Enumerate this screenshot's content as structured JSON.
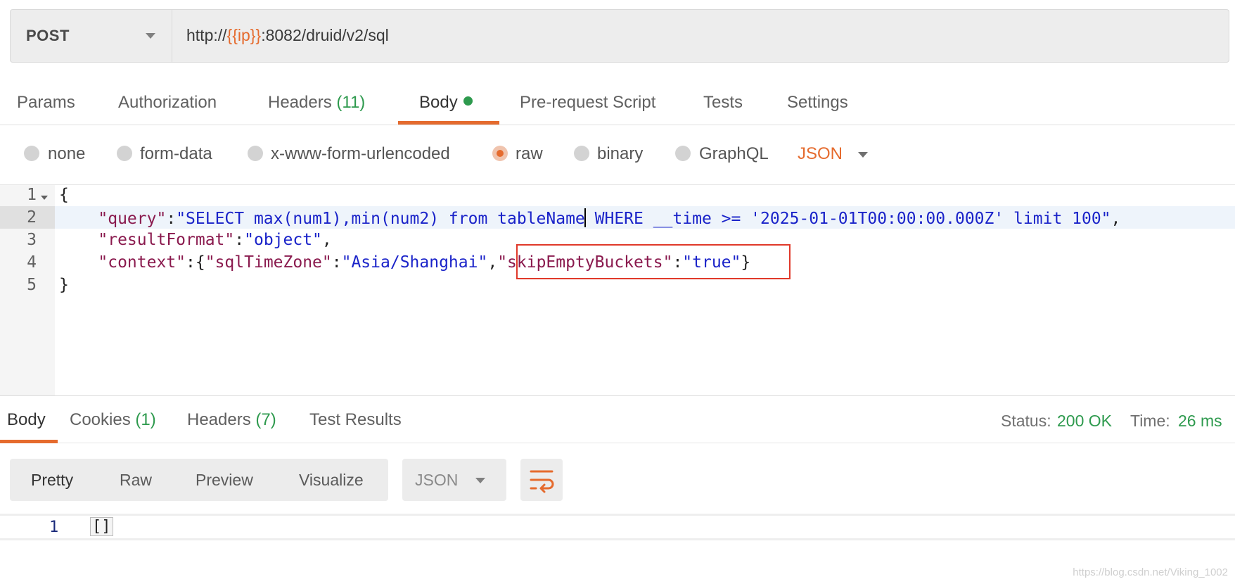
{
  "request": {
    "method": "POST",
    "url": {
      "prefix": "http://",
      "variable": "{{ip}}",
      "suffix": ":8082/druid/v2/sql"
    }
  },
  "request_tabs": {
    "params": "Params",
    "authorization": "Authorization",
    "headers": "Headers",
    "headers_count": "(11)",
    "body": "Body",
    "pre_request": "Pre-request Script",
    "tests": "Tests",
    "settings": "Settings"
  },
  "body_types": {
    "none": "none",
    "form_data": "form-data",
    "urlencoded": "x-www-form-urlencoded",
    "raw": "raw",
    "binary": "binary",
    "graphql": "GraphQL",
    "language": "JSON",
    "selected": "raw"
  },
  "editor": {
    "line_numbers": [
      "1",
      "2",
      "3",
      "4",
      "5"
    ],
    "line1": "{",
    "line2": {
      "indent": "    ",
      "key": "\"query\"",
      "colon": ":",
      "value_a": "\"SELECT max(num1),min(num2) from tableName",
      "value_b": " WHERE __time >= '2025-01-01T00:00:00.000Z' limit 100\"",
      "comma": ","
    },
    "line3": {
      "indent": "    ",
      "key": "\"resultFormat\"",
      "colon": ":",
      "value": "\"object\"",
      "comma": ","
    },
    "line4": {
      "indent": "    ",
      "key": "\"context\"",
      "colon": ":",
      "brace_open": "{",
      "k1": "\"sqlTimeZone\"",
      "colon1": ":",
      "v1": "\"Asia/Shanghai\"",
      "comma1": ",",
      "k2": "\"skipEmptyBuckets\"",
      "colon2": ":",
      "v2": "\"true\"",
      "brace_close": "}"
    },
    "line5": "}"
  },
  "response_tabs": {
    "body": "Body",
    "cookies": "Cookies",
    "cookies_count": "(1)",
    "headers": "Headers",
    "headers_count": "(7)",
    "test_results": "Test Results"
  },
  "status": {
    "status_label": "Status:",
    "status_value": "200 OK",
    "time_label": "Time:",
    "time_value": "26 ms"
  },
  "view_modes": {
    "pretty": "Pretty",
    "raw": "Raw",
    "preview": "Preview",
    "visualize": "Visualize",
    "format": "JSON"
  },
  "response": {
    "line_number": "1",
    "content": "[]"
  },
  "watermark": "https://blog.csdn.net/Viking_1002",
  "colors": {
    "accent": "#e56b2e",
    "success": "#2e9a4e",
    "highlight_box": "#e0392a",
    "json_key": "#8a1a4e",
    "json_string": "#1a23c9"
  }
}
